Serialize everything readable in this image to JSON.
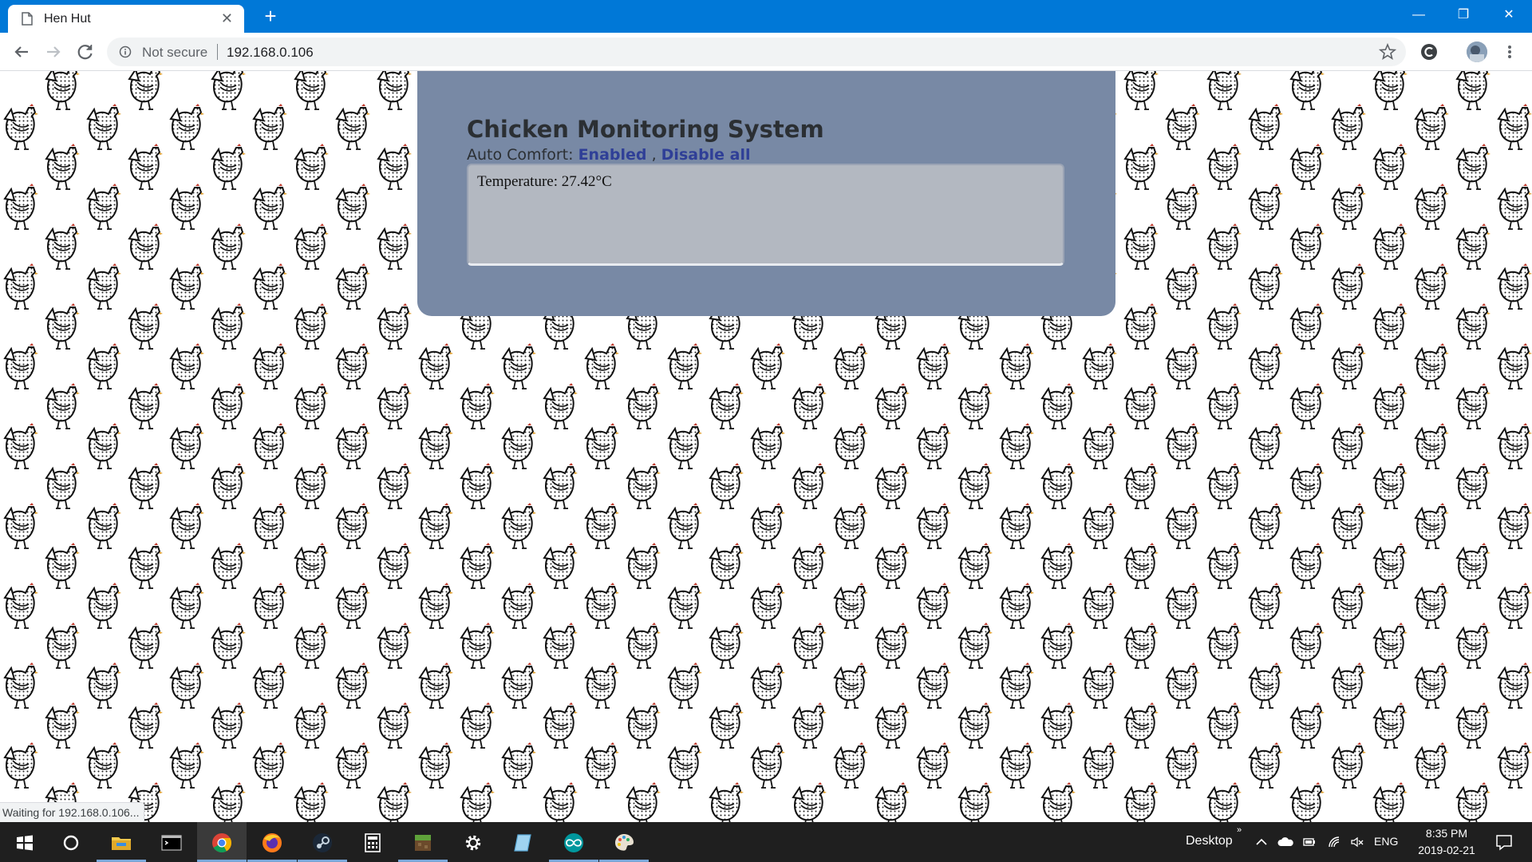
{
  "browser": {
    "tab_title": "Hen Hut",
    "tab_close": "✕",
    "new_tab": "+",
    "security_label": "Not secure",
    "url": "192.168.0.106",
    "status_text": "Waiting for 192.168.0.106...",
    "window_controls": {
      "minimize": "—",
      "maximize": "❐",
      "close": "✕"
    }
  },
  "page": {
    "title": "Chicken Monitoring System",
    "comfort_label": "Auto Comfort:",
    "comfort_status_link": "Enabled",
    "comfort_separator": ",",
    "comfort_action_link": "Disable all",
    "temperature_text": "Temperature: 27.42°C",
    "background_pattern": "chicken-pattern"
  },
  "taskbar": {
    "apps": [
      "start-icon",
      "cortana-icon",
      "file-explorer-icon",
      "terminal-icon",
      "chrome-icon",
      "firefox-icon",
      "steam-icon",
      "calculator-icon",
      "minecraft-icon",
      "settings-icon",
      "notepad-icon",
      "arduino-icon",
      "paint-icon"
    ],
    "active_app": "chrome-icon",
    "desktop_label": "Desktop",
    "chevron": "»",
    "language": "ENG",
    "time": "8:35 PM",
    "date": "2019-02-21"
  },
  "colors": {
    "titlebar": "#0078d7",
    "panel": "#7889a5",
    "readout": "#b3b8c1",
    "link": "#2f3f97",
    "taskbar": "#1f1f1f"
  }
}
